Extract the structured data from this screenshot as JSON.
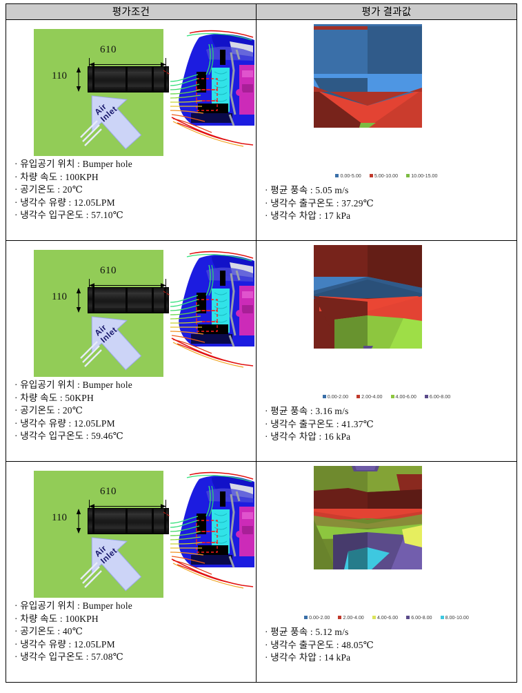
{
  "table": {
    "headers": [
      "평가조건",
      "평가 결과값"
    ]
  },
  "rows": [
    {
      "diagram": {
        "width_label": "610",
        "height_label": "110",
        "air_inlet_label": "Air\nInlet"
      },
      "conditions": [
        "· 유입공기 위치 : Bumper hole",
        "· 차량 속도 : 100KPH",
        "· 공기온도 : 20℃",
        "· 냉각수 유량 : 12.05LPM",
        "· 냉각수 입구온도 : 57.10℃"
      ],
      "legend": [
        {
          "label": "0.00-5.00",
          "color": "#3a6fa8"
        },
        {
          "label": "5.00-10.00",
          "color": "#c0392b"
        },
        {
          "label": "10.00-15.00",
          "color": "#7cbb43"
        }
      ],
      "results": [
        "· 평균 풍속 : 5.05 m/s",
        "· 냉각수 출구온도 : 37.29℃",
        "· 냉각수 차압 : 17 kPa"
      ]
    },
    {
      "diagram": {
        "width_label": "610",
        "height_label": "110",
        "air_inlet_label": "Air\nInlet"
      },
      "conditions": [
        "· 유입공기 위치 : Bumper hole",
        "· 차량 속도 : 50KPH",
        "· 공기온도 : 20℃",
        "· 냉각수 유량 : 12.05LPM",
        "· 냉각수 입구온도 : 59.46℃"
      ],
      "legend": [
        {
          "label": "0.00-2.00",
          "color": "#3a6fa8"
        },
        {
          "label": "2.00-4.00",
          "color": "#c0392b"
        },
        {
          "label": "4.00-6.00",
          "color": "#8dc63f"
        },
        {
          "label": "6.00-8.00",
          "color": "#5b4b8a"
        }
      ],
      "results": [
        "· 평균 풍속 : 3.16 m/s",
        "· 냉각수 출구온도 : 41.37℃",
        "· 냉각수 차압 : 16 kPa"
      ]
    },
    {
      "diagram": {
        "width_label": "610",
        "height_label": "110",
        "air_inlet_label": "Air\nInlet"
      },
      "conditions": [
        "· 유입공기 위치 : Bumper hole",
        "· 차량 속도 : 100KPH",
        "· 공기온도 : 40℃",
        "· 냉각수 유량 : 12.05LPM",
        "· 냉각수 입구온도 : 57.08℃"
      ],
      "legend": [
        {
          "label": "0.00-2.00",
          "color": "#3a6fa8"
        },
        {
          "label": "2.00-4.00",
          "color": "#c0392b"
        },
        {
          "label": "4.00-6.00",
          "color": "#dbe35a"
        },
        {
          "label": "6.00-8.00",
          "color": "#5b4b8a"
        },
        {
          "label": "8.00-10.00",
          "color": "#3ec8e0"
        }
      ],
      "results": [
        "· 평균 풍속 : 5.12 m/s",
        "· 냉각수 출구온도 : 48.05℃",
        "· 냉각수 차압 : 14 kPa"
      ]
    }
  ],
  "chart_data": [
    {
      "type": "heatmap",
      "title": "",
      "description": "Row 1 airflow velocity contour across condenser face",
      "units": "m/s",
      "bands": [
        "0.00-5.00",
        "5.00-10.00",
        "10.00-15.00"
      ],
      "band_colors": [
        "#3a6fa8",
        "#c0392b",
        "#7cbb43"
      ],
      "mean_velocity": 5.05,
      "coolant_outlet_temp": 37.29,
      "coolant_pressure_drop": 17
    },
    {
      "type": "heatmap",
      "title": "",
      "description": "Row 2 airflow velocity contour across condenser face",
      "units": "m/s",
      "bands": [
        "0.00-2.00",
        "2.00-4.00",
        "4.00-6.00",
        "6.00-8.00"
      ],
      "band_colors": [
        "#3a6fa8",
        "#c0392b",
        "#8dc63f",
        "#5b4b8a"
      ],
      "mean_velocity": 3.16,
      "coolant_outlet_temp": 41.37,
      "coolant_pressure_drop": 16
    },
    {
      "type": "heatmap",
      "title": "",
      "description": "Row 3 airflow velocity contour across condenser face",
      "units": "m/s",
      "bands": [
        "0.00-2.00",
        "2.00-4.00",
        "4.00-6.00",
        "6.00-8.00",
        "8.00-10.00"
      ],
      "band_colors": [
        "#3a6fa8",
        "#c0392b",
        "#dbe35a",
        "#5b4b8a",
        "#3ec8e0"
      ],
      "mean_velocity": 5.12,
      "coolant_outlet_temp": 48.05,
      "coolant_pressure_drop": 14
    }
  ]
}
